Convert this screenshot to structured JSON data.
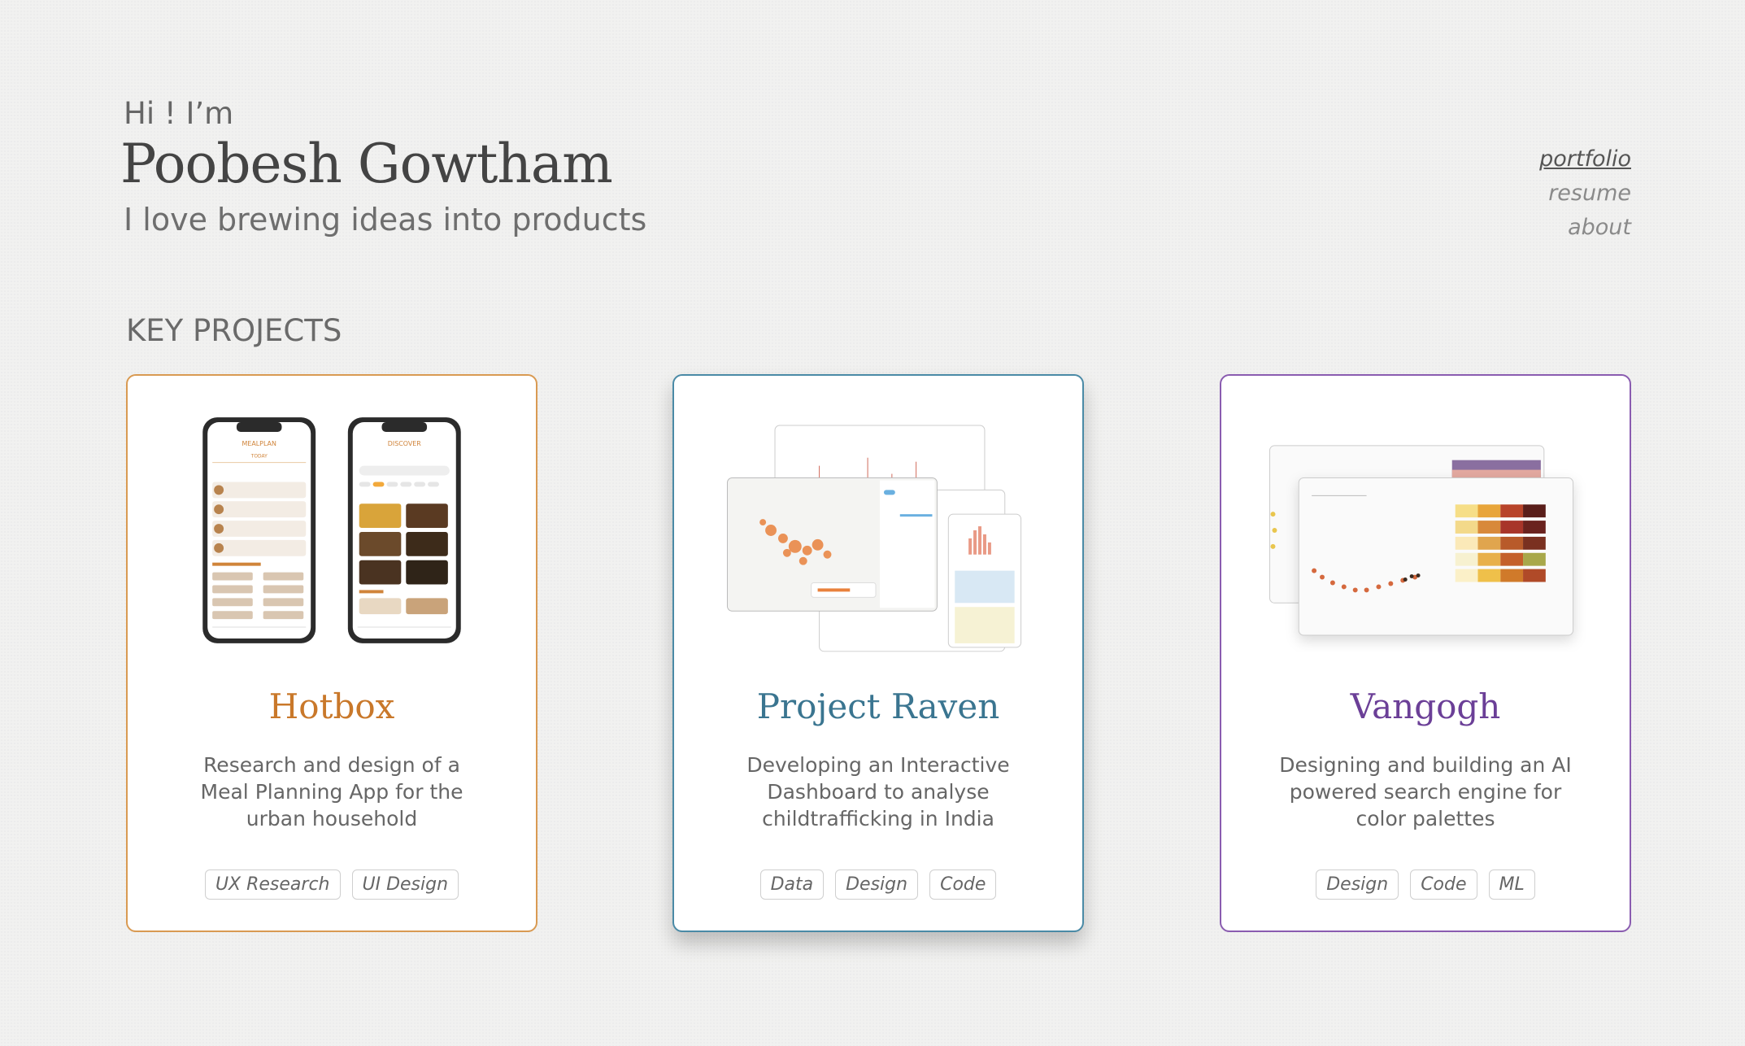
{
  "header": {
    "greeting": "Hi ! I’m",
    "name": "Poobesh Gowtham",
    "tagline": "I love brewing ideas into products"
  },
  "nav": {
    "items": [
      {
        "label": "portfolio",
        "active": true
      },
      {
        "label": "resume",
        "active": false
      },
      {
        "label": "about",
        "active": false
      }
    ]
  },
  "section": {
    "title": "KEY PROJECTS"
  },
  "projects": [
    {
      "title": "Hotbox",
      "description": "Research and design of a Meal Planning App for the urban household",
      "tags": [
        "UX Research",
        "UI Design"
      ],
      "color": "#c9782a",
      "thumbnail_texts": [
        "MEALPLAN",
        "TODAY",
        "DISCOVER"
      ]
    },
    {
      "title": "Project Raven",
      "description": "Developing an Interactive Dashboard to analyse childtrafficking in India",
      "tags": [
        "Data",
        "Design",
        "Code"
      ],
      "color": "#3a7590"
    },
    {
      "title": "Vangogh",
      "description": "Designing and building an AI powered search engine for color palettes",
      "tags": [
        "Design",
        "Code",
        "ML"
      ],
      "color": "#6b3f97"
    }
  ]
}
